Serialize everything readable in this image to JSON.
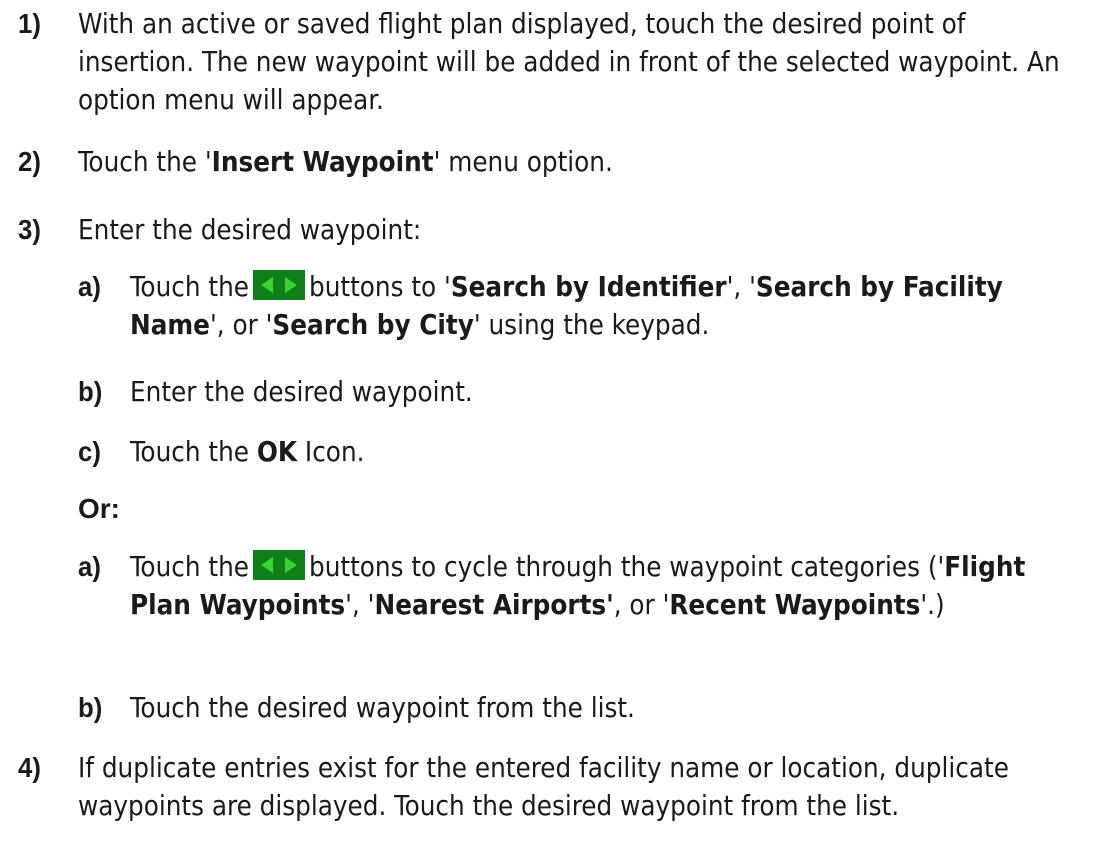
{
  "steps": [
    {
      "num": "1)",
      "text": "With an active or saved flight plan displayed, touch the desired point of insertion.  The new waypoint will be added in front of the selected waypoint.  An option menu will appear."
    },
    {
      "num": "2)",
      "pre": "Touch the '",
      "bold": "Insert Waypoint",
      "post": "' menu option."
    },
    {
      "num": "3)",
      "text": "Enter the desired waypoint:"
    },
    {
      "num": "4)",
      "text": "If duplicate entries exist for the entered facility name or location, duplicate waypoints are displayed.  Touch the desired waypoint from the list."
    }
  ],
  "sub_a1": {
    "num": "a)",
    "pre": "Touch the",
    "post1": "buttons to '",
    "b1": "Search by Identifier",
    "sep1": "', '",
    "b2": "Search by Facility Name",
    "sep2": "', or '",
    "b3": "Search by City",
    "post2": "' using the keypad."
  },
  "sub_b1": {
    "num": "b)",
    "text": "Enter the desired waypoint."
  },
  "sub_c1": {
    "num": "c)",
    "pre": "Touch the ",
    "bold": "OK",
    "post": " Icon."
  },
  "or_label": "Or:",
  "sub_a2": {
    "num": "a)",
    "pre": "Touch the",
    "post1": "buttons to cycle through the waypoint categories ('",
    "b1": "Flight Plan Waypoints",
    "sep1": "', '",
    "b2": "Nearest Airports'",
    "sep2": ", or '",
    "b3": "Recent Waypoints",
    "post2": "'.)"
  },
  "sub_b2": {
    "num": "b)",
    "text": "Touch the desired waypoint from the list."
  },
  "icons": {
    "arrow_buttons": "left-right-arrow-buttons",
    "color_bg": "#0f7f1a",
    "color_arrow": "#37d335"
  }
}
